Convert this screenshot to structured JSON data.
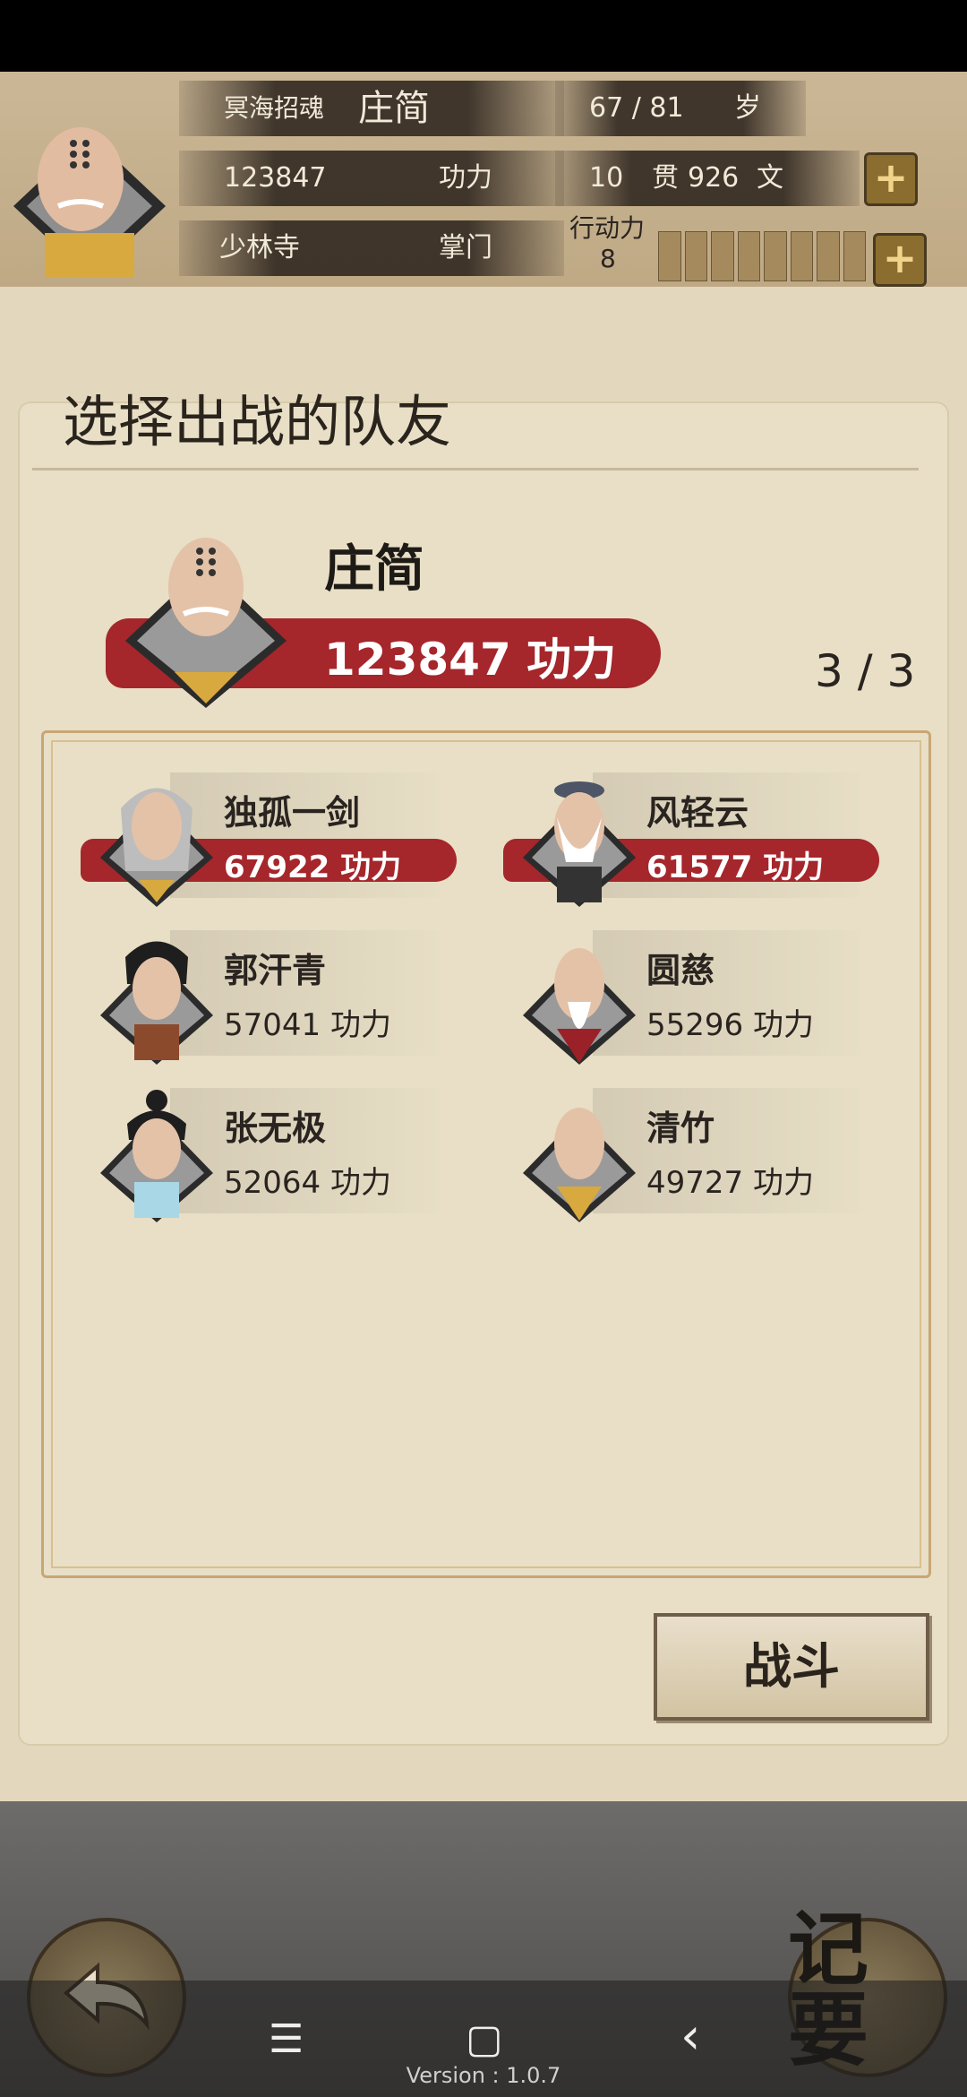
{
  "header": {
    "title_label": "冥海招魂",
    "player_name": "庄简",
    "age_value": "67 / 81",
    "age_unit": "岁",
    "power_value": "123847",
    "power_label": "功力",
    "money_guan": "10",
    "money_guan_unit": "贯",
    "money_wen": "926",
    "money_wen_unit": "文",
    "sect": "少林寺",
    "role": "掌门",
    "action_label": "行动力",
    "action_value": "8",
    "plus_symbol": "+"
  },
  "main": {
    "title": "选择出战的队友",
    "leader": {
      "name": "庄简",
      "power": "123847 功力"
    },
    "count": "3 / 3",
    "teammates": [
      {
        "name": "独孤一剑",
        "power": "67922 功力",
        "selected": true
      },
      {
        "name": "风轻云",
        "power": "61577 功力",
        "selected": true
      },
      {
        "name": "郭汗青",
        "power": "57041 功力",
        "selected": false
      },
      {
        "name": "圆慈",
        "power": "55296 功力",
        "selected": false
      },
      {
        "name": "张无极",
        "power": "52064 功力",
        "selected": false
      },
      {
        "name": "清竹",
        "power": "49727 功力",
        "selected": false
      }
    ],
    "fight_button": "战斗"
  },
  "footer": {
    "notes_label": "记要",
    "version": "Version : 1.0.7",
    "nav_menu": "☰",
    "nav_home": "▢",
    "nav_back": "‹"
  },
  "colors": {
    "accent_red": "#a5262b",
    "panel_bg": "#e8dfc6",
    "gold": "#8a6d2f"
  }
}
